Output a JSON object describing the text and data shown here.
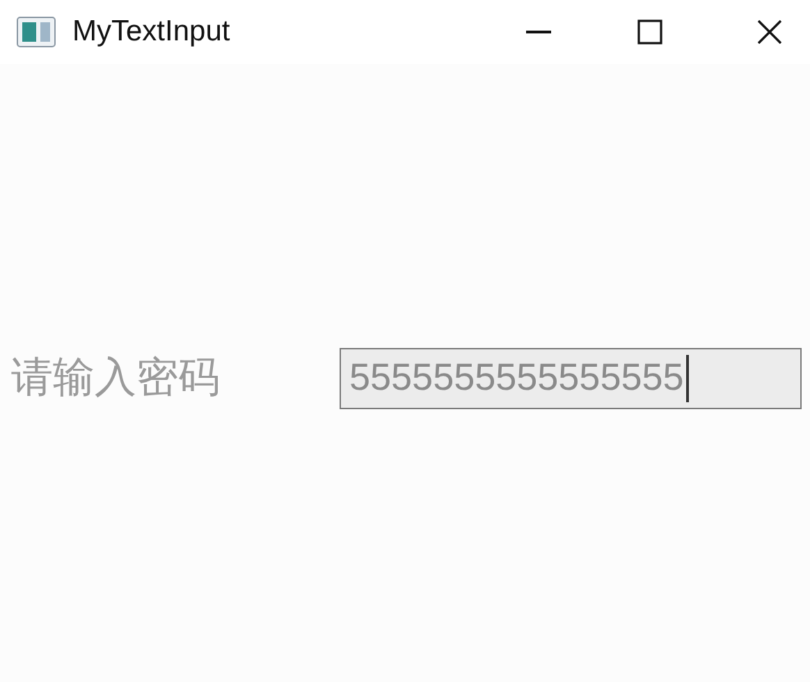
{
  "window": {
    "title": "MyTextInput"
  },
  "form": {
    "label": "请输入密码",
    "field": {
      "value": "5555555555555555",
      "focused": true
    }
  }
}
